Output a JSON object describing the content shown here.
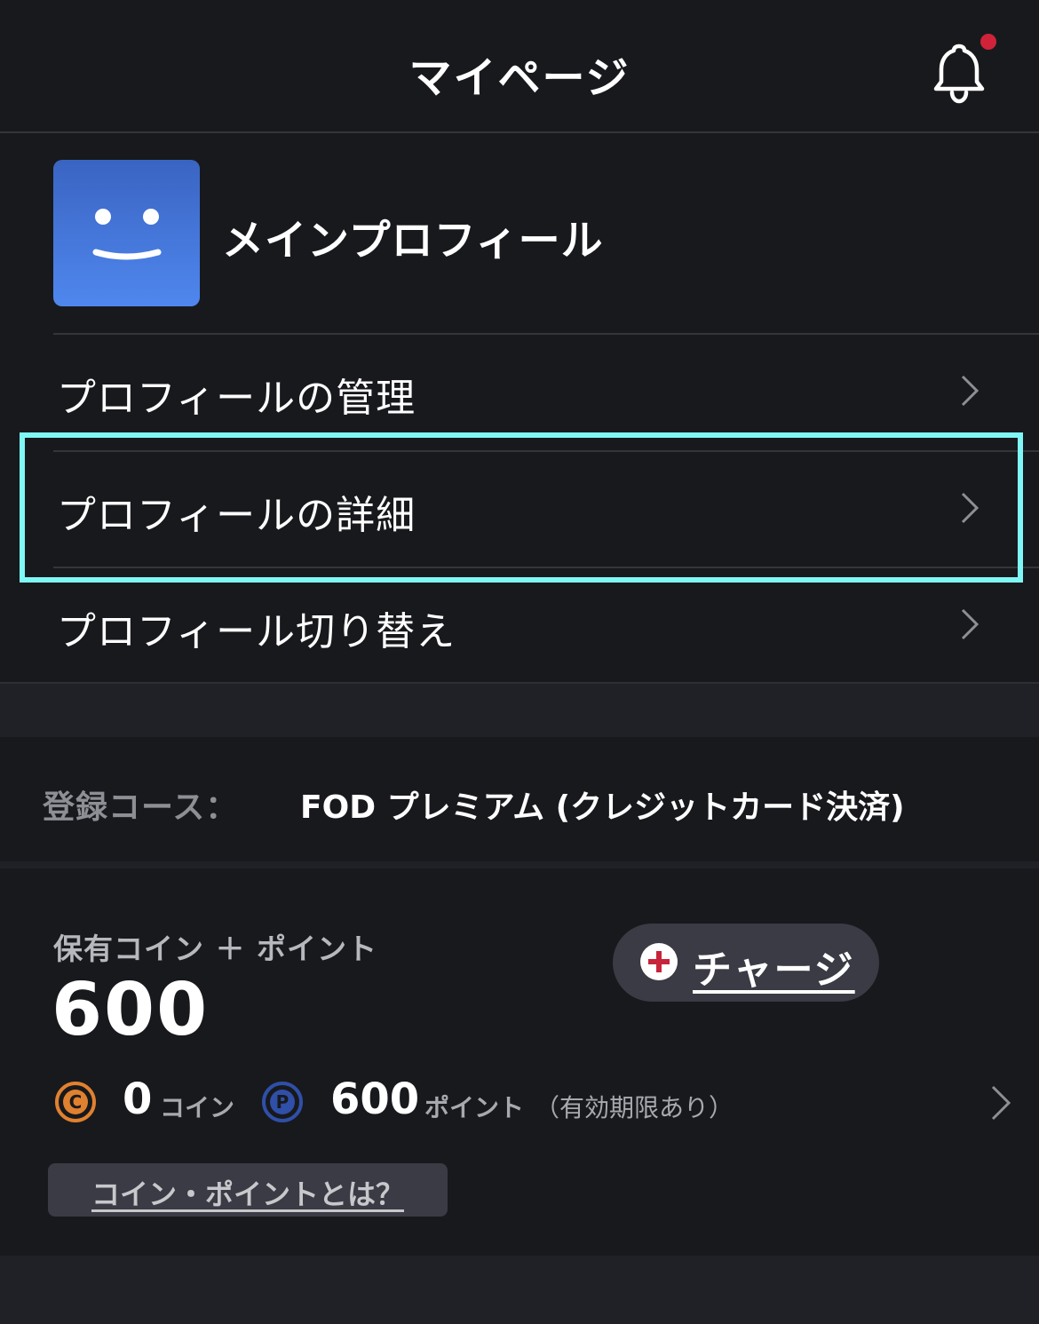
{
  "header": {
    "title": "マイページ",
    "notification_icon": "bell-icon",
    "has_unread": true
  },
  "profile": {
    "name": "メインプロフィール",
    "avatar_icon": "smiley-face-icon",
    "menu": [
      {
        "label": "プロフィールの管理"
      },
      {
        "label": "プロフィールの詳細",
        "highlighted": true
      },
      {
        "label": "プロフィール切り替え"
      }
    ]
  },
  "course": {
    "label": "登録コース：",
    "value": "FOD プレミアム (クレジットカード決済)"
  },
  "coins": {
    "caption": "保有コイン ＋ ポイント",
    "total": "600",
    "charge_label": "チャージ",
    "coin_count": "0",
    "coin_unit": "コイン",
    "point_count": "600",
    "point_unit": "ポイント",
    "expiry_note": "（有効期限あり）",
    "help_label": "コイン・ポイントとは？"
  },
  "colors": {
    "background": "#18191d",
    "accent_highlight": "#7ff8f5",
    "notification_dot": "#d0233a",
    "coin": "#e0812f",
    "point": "#2f4fa8",
    "charge_plus": "#c8233b"
  }
}
